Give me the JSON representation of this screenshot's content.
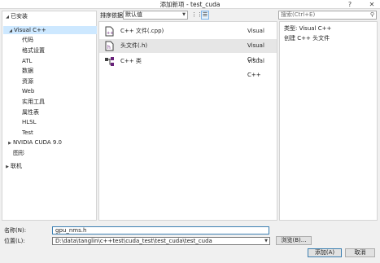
{
  "window": {
    "title": "添加新项 - test_cuda",
    "help_button": "?",
    "close_button": "✕"
  },
  "tree": {
    "installed": "已安装",
    "visual_cpp": "Visual C++",
    "children": [
      "代码",
      "格式设置",
      "ATL",
      "数据",
      "资源",
      "Web",
      "实用工具",
      "属性表",
      "HLSL",
      "Test"
    ],
    "nvidia": "NVIDIA CUDA 9.0",
    "graphics": "图形",
    "online": "联机"
  },
  "toolbar": {
    "sort_label": "排序依据:",
    "sort_value": "默认值",
    "search_placeholder": "搜索(Ctrl+E)"
  },
  "templates": [
    {
      "name": "C++ 文件(.cpp)",
      "lang": "Visual C++",
      "icon": "cpp-file-icon"
    },
    {
      "name": "头文件(.h)",
      "lang": "Visual C++",
      "icon": "header-file-icon"
    },
    {
      "name": "C++ 类",
      "lang": "Visual C++",
      "icon": "class-icon"
    }
  ],
  "details": {
    "type_label": "类型:",
    "type_value": "Visual C++",
    "description": "创建 C++ 头文件"
  },
  "form": {
    "name_label": "名称(N):",
    "name_value": "gpu_nms.h",
    "location_label": "位置(L):",
    "location_value": "D:\\data\\tanglin\\c++test\\cuda_test\\test_cuda\\test_cuda",
    "browse_label": "浏览(B)...",
    "add_label": "添加(A)",
    "cancel_label": "取消"
  },
  "colors": {
    "selection": "#cde8ff",
    "focus_border": "#3c7fb1",
    "icon_purple": "#68217a",
    "background": "#f0f0f0"
  }
}
